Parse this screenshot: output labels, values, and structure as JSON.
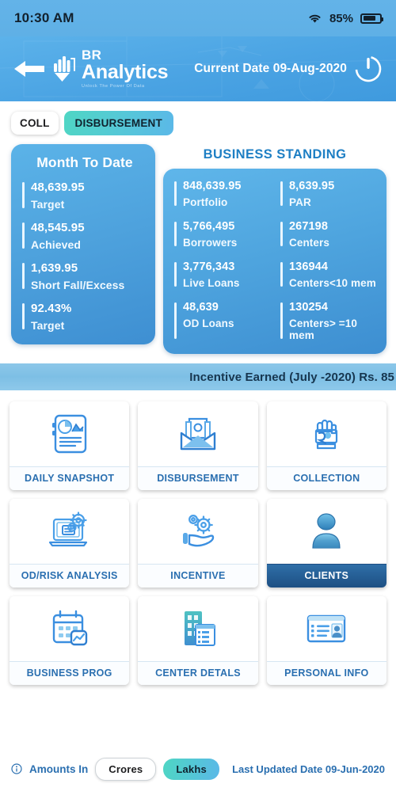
{
  "statusbar": {
    "time": "10:30 AM",
    "battery_percent": "85%",
    "wifi_icon": "wifi-icon",
    "battery_icon": "battery-icon",
    "battery_level": 75
  },
  "header": {
    "back_icon": "back-arrow-icon",
    "logo_icon": "br-analytics-logo-icon",
    "logo_line1": "BR",
    "logo_line2": "Analytics",
    "logo_tagline": "Unlock The Power Of Data",
    "current_date": "Current Date 09-Aug-2020",
    "power_icon": "power-icon"
  },
  "tabs": [
    {
      "label": "COLL",
      "selected": false
    },
    {
      "label": "DISBURSEMENT",
      "selected": true
    }
  ],
  "month_to_date": {
    "title": "Month To Date",
    "stats": [
      {
        "value": "48,639.95",
        "label": "Target"
      },
      {
        "value": "48,545.95",
        "label": "Achieved"
      },
      {
        "value": "1,639.95",
        "label": "Short Fall/Excess"
      },
      {
        "value": "92.43%",
        "label": "Target"
      }
    ]
  },
  "business_standing": {
    "title": "BUSINESS STANDING",
    "stats": [
      {
        "value": "848,639.95",
        "label": "Portfolio"
      },
      {
        "value": "8,639.95",
        "label": "PAR"
      },
      {
        "value": "5,766,495",
        "label": "Borrowers"
      },
      {
        "value": "267198",
        "label": "Centers"
      },
      {
        "value": "3,776,343",
        "label": "Live Loans"
      },
      {
        "value": "136944",
        "label": "Centers<10 mem"
      },
      {
        "value": "48,639",
        "label": "OD Loans"
      },
      {
        "value": "130254",
        "label": "Centers> =10 mem"
      }
    ]
  },
  "incentive_band": {
    "text": "Incentive Earned (July -2020) Rs. 85"
  },
  "tiles": [
    {
      "label": "DAILY SNAPSHOT",
      "icon": "report-document-icon",
      "selected": false
    },
    {
      "label": "DISBURSEMENT",
      "icon": "envelope-money-icon",
      "selected": false
    },
    {
      "label": "COLLECTION",
      "icon": "hand-money-icon",
      "selected": false
    },
    {
      "label": "OD/RISK ANALYSIS",
      "icon": "laptop-gears-icon",
      "selected": false
    },
    {
      "label": "INCENTIVE",
      "icon": "hand-gears-icon",
      "selected": false
    },
    {
      "label": "CLIENTS",
      "icon": "person-icon",
      "selected": true
    },
    {
      "label": "BUSINESS PROG",
      "icon": "calendar-chart-icon",
      "selected": false
    },
    {
      "label": "CENTER DETALS",
      "icon": "building-list-icon",
      "selected": false
    },
    {
      "label": "PERSONAL INFO",
      "icon": "id-card-icon",
      "selected": false
    }
  ],
  "bottombar": {
    "info_icon": "info-icon",
    "amounts_label": "Amounts In",
    "units": [
      {
        "label": "Crores",
        "selected": false
      },
      {
        "label": "Lakhs",
        "selected": true
      }
    ],
    "last_updated": "Last Updated Date 09-Jun-2020"
  },
  "colors": {
    "header_blue": "#4aa3e3",
    "card_blue": "#4ea2dd",
    "accent_teal": "#4fd6c4",
    "title_blue": "#1e7fc4",
    "selected_tile": "#1d4f83",
    "band_blue": "#7dbfe5"
  }
}
